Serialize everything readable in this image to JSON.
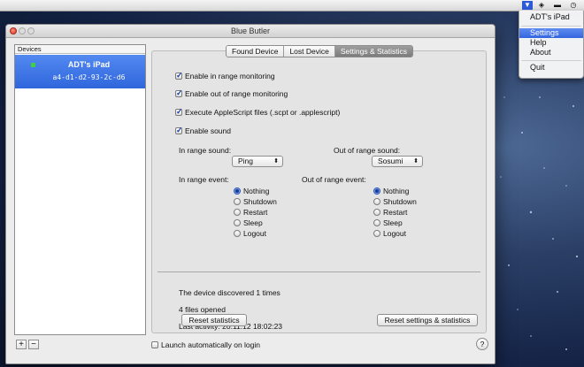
{
  "menubar": {
    "icons": [
      "shield-app-icon",
      "sync-icon",
      "display-icon",
      "clock-icon"
    ]
  },
  "status_menu": {
    "device_label": "ADT's iPad",
    "items": [
      "Settings",
      "Help",
      "About",
      "Quit"
    ],
    "selected": "Settings"
  },
  "window": {
    "title": "Blue Butler"
  },
  "devices": {
    "header": "Devices",
    "items": [
      {
        "name": "ADT's iPad",
        "id": "a4-d1-d2-93-2c-d6",
        "status_color": "#3ed23e"
      }
    ],
    "add_label": "+",
    "remove_label": "−"
  },
  "tabs": [
    "Found Device",
    "Lost Device",
    "Settings & Statistics"
  ],
  "active_tab": "Settings & Statistics",
  "settings": {
    "checkboxes": [
      {
        "label": "Enable in range monitoring",
        "checked": true
      },
      {
        "label": "Enable out of range monitoring",
        "checked": true
      },
      {
        "label": "Execute AppleScript files (.scpt or .applescript)",
        "checked": true
      },
      {
        "label": "Enable sound",
        "checked": true
      }
    ],
    "in_range_sound_label": "In range sound:",
    "in_range_sound_value": "Ping",
    "out_range_sound_label": "Out of range sound:",
    "out_range_sound_value": "Sosumi",
    "in_range_event_label": "In range event:",
    "out_range_event_label": "Out of range event:",
    "event_options": [
      "Nothing",
      "Shutdown",
      "Restart",
      "Sleep",
      "Logout"
    ],
    "in_range_event_selected": "Nothing",
    "out_range_event_selected": "Nothing"
  },
  "stats": {
    "discovered": "The device discovered 1 times",
    "files_opened": "4 files opened",
    "last_activity": "Last activity: 20.11.12 18:02:23",
    "reset_stats_label": "Reset statistics",
    "reset_all_label": "Reset settings & statistics"
  },
  "footer": {
    "launch_label": "Launch automatically on login",
    "launch_checked": false,
    "help_label": "?"
  },
  "colors": {
    "selection": "#3465e0",
    "device_online": "#3ed23e"
  }
}
